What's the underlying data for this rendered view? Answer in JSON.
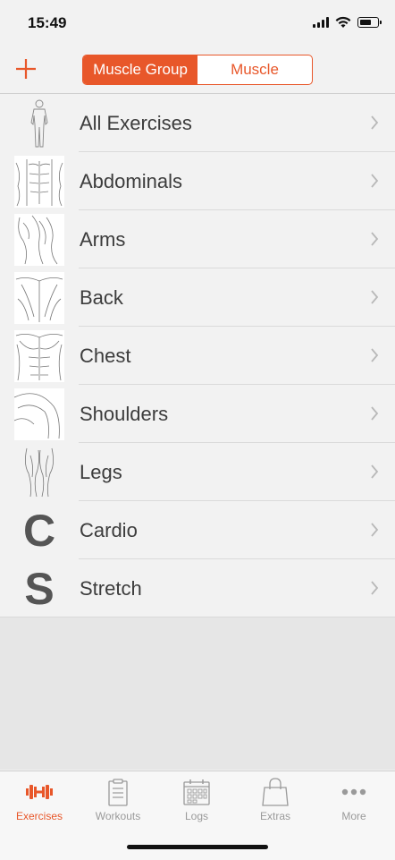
{
  "status_bar": {
    "time": "15:49"
  },
  "segmented_control": {
    "options": [
      "Muscle Group",
      "Muscle"
    ],
    "selected": "Muscle Group"
  },
  "list": {
    "items": [
      {
        "label": "All Exercises",
        "thumbnail": "body-figure-icon"
      },
      {
        "label": "Abdominals",
        "thumbnail": "abdominals-icon"
      },
      {
        "label": "Arms",
        "thumbnail": "arms-icon"
      },
      {
        "label": "Back",
        "thumbnail": "back-icon"
      },
      {
        "label": "Chest",
        "thumbnail": "chest-icon"
      },
      {
        "label": "Shoulders",
        "thumbnail": "shoulders-icon"
      },
      {
        "label": "Legs",
        "thumbnail": "legs-icon"
      },
      {
        "label": "Cardio",
        "thumbnail": "letter-c-icon",
        "letter": "C"
      },
      {
        "label": "Stretch",
        "thumbnail": "letter-s-icon",
        "letter": "S"
      }
    ]
  },
  "tab_bar": {
    "tabs": [
      {
        "label": "Exercises",
        "icon": "dumbbell-icon",
        "active": true
      },
      {
        "label": "Workouts",
        "icon": "clipboard-icon",
        "active": false
      },
      {
        "label": "Logs",
        "icon": "calendar-icon",
        "active": false
      },
      {
        "label": "Extras",
        "icon": "shopping-bag-icon",
        "active": false
      },
      {
        "label": "More",
        "icon": "more-dots-icon",
        "active": false
      }
    ]
  },
  "colors": {
    "accent": "#e8572a",
    "inactive": "#9a9a9a",
    "text": "#3c3c3c",
    "background": "#f2f2f2"
  }
}
